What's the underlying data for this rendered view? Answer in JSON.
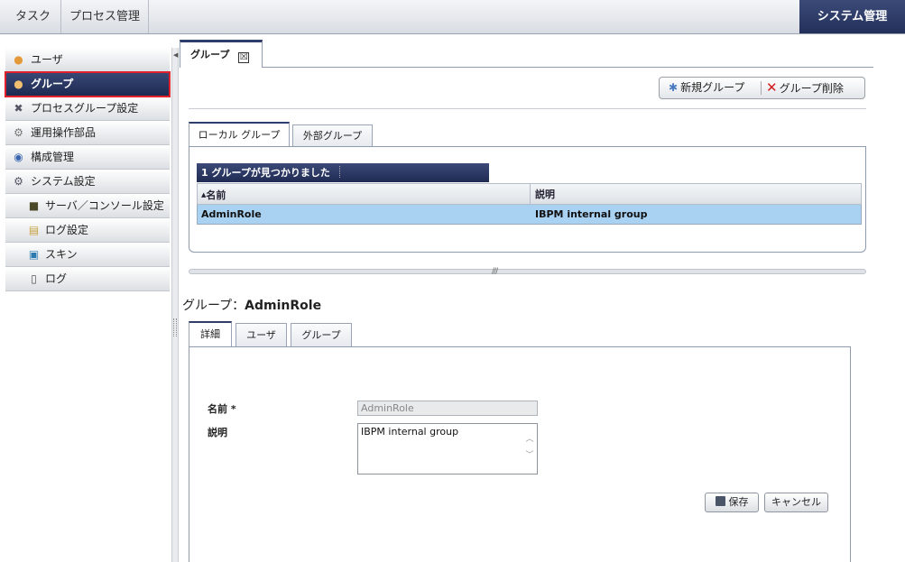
{
  "top_nav": {
    "tab_task": "タスク",
    "tab_process": "プロセス管理",
    "tab_system": "システム管理"
  },
  "sidebar": {
    "items": [
      {
        "label": "ユーザ",
        "icon": "user-icon"
      },
      {
        "label": "グループ",
        "icon": "group-icon",
        "active": true
      },
      {
        "label": "プロセスグループ設定",
        "icon": "tools-icon"
      },
      {
        "label": "運用操作部品",
        "icon": "gear-icon"
      },
      {
        "label": "構成管理",
        "icon": "config-icon"
      },
      {
        "label": "システム設定",
        "icon": "settings-icon"
      },
      {
        "label": "サーバ／コンソール設定",
        "icon": "server-icon"
      },
      {
        "label": "ログ設定",
        "icon": "log-settings-icon"
      },
      {
        "label": "スキン",
        "icon": "skin-icon"
      },
      {
        "label": "ログ",
        "icon": "log-icon"
      }
    ]
  },
  "doc_tab": {
    "label": "グループ",
    "close": "☒"
  },
  "toolbar": {
    "new_group": "新規グループ",
    "delete_group": "グループ削除"
  },
  "group_tabs": {
    "local": "ローカル グループ",
    "external": "外部グループ"
  },
  "grid": {
    "count_text": "1 グループが見つかりました",
    "columns": [
      "名前",
      "説明"
    ],
    "rows": [
      {
        "name": "AdminRole",
        "description": "IBPM internal group"
      }
    ]
  },
  "detail": {
    "title_prefix": "グループ：",
    "title_name": "AdminRole",
    "tabs": [
      "詳細",
      "ユーザ",
      "グループ"
    ],
    "name_label": "名前 *",
    "name_value": "AdminRole",
    "desc_label": "説明",
    "desc_value": "IBPM internal group",
    "save": "保存",
    "cancel": "キャンセル"
  },
  "colors": {
    "accent_dark": "#22305a",
    "selected_row": "#a9d1f2",
    "highlight_border": "#e0202a"
  }
}
